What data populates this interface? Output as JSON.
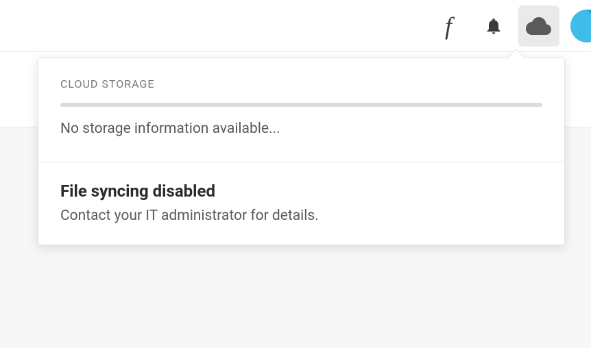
{
  "cloud_popover": {
    "heading": "CLOUD STORAGE",
    "status_text": "No storage information available...",
    "sync_title": "File syncing disabled",
    "sync_subtitle": "Contact your IT administrator for details."
  }
}
